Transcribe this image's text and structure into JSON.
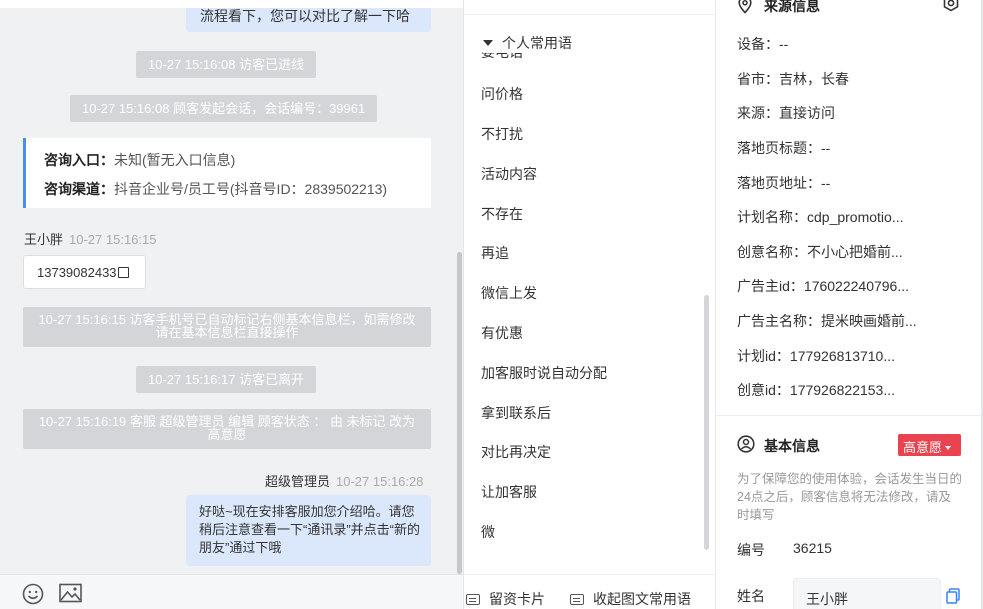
{
  "chat": {
    "top_bubble_text": "流程看下，您可以对比了解一下哈",
    "sys_visitor_enter": "10-27 15:16:08 访客已进线",
    "sys_session_start": "10-27 15:16:08 顾客发起会话，会话编号：39961",
    "consult": {
      "entry_label": "咨询入口：",
      "entry_value": "未知(暂无入口信息)",
      "channel_label": "咨询渠道：",
      "channel_value": "抖音企业号/员工号(抖音号ID：2839502213)"
    },
    "visitor_name": "王小胖",
    "visitor_time": "10-27 15:16:15",
    "visitor_phone": "13739082433",
    "sys_phone_marked": "10-27 15:16:15 访客手机号已自动标记右侧基本信息栏，如需修改请在基本信息栏直接操作",
    "sys_visitor_left": "10-27 15:16:17 访客已离开",
    "sys_status_edit": "10-27 15:16:19 客服 超级管理员 编辑 顾客状态 ： 由 未标记 改为 高意愿",
    "agent_name": "超级管理员",
    "agent_time": "10-27 15:16:28",
    "agent_message": "好哒~现在安排客服加您介绍哈。请您稍后注意查看一下“通讯录”并点击“新的朋友”通过下哦"
  },
  "phrases": {
    "group_title": "个人常用语",
    "clipped_item": "要电话",
    "items": [
      "问价格",
      "不打扰",
      "活动内容",
      "不存在",
      "再追",
      "微信上发",
      "有优惠",
      "加客服时说自动分配",
      "拿到联系后",
      "对比再决定",
      "让加客服",
      "微"
    ],
    "btn_card": "留资卡片",
    "btn_collapse": "收起图文常用语"
  },
  "info": {
    "source_title": "来源信息",
    "rows": [
      {
        "label": "设备：",
        "value": "--"
      },
      {
        "label": "省市：",
        "value": "吉林，长春"
      },
      {
        "label": "来源：",
        "value": "直接访问"
      },
      {
        "label": "落地页标题：",
        "value": "--"
      },
      {
        "label": "落地页地址：",
        "value": "--"
      },
      {
        "label": "计划名称：",
        "value": "cdp_promotio..."
      },
      {
        "label": "创意名称：",
        "value": "不小心把婚前..."
      },
      {
        "label": "广告主id：",
        "value": "176022240796..."
      },
      {
        "label": "广告主名称：",
        "value": "提米映画婚前..."
      },
      {
        "label": "计划id：",
        "value": "177926813710..."
      },
      {
        "label": "创意id：",
        "value": "177926822153..."
      }
    ],
    "basic_title": "基本信息",
    "intent_badge": "高意愿",
    "notice": "为了保障您的使用体验，会话发生当日的24点之后，顾客信息将无法修改，请及时填写",
    "number_label": "编号",
    "number_value": "36215",
    "name_label": "姓名",
    "name_value": "王小胖"
  },
  "colors": {
    "accent_blue": "#4a8df0",
    "bubble_blue": "#dbe8fc",
    "badge_red": "#e8434e",
    "system_gray": "#d3d5d8"
  }
}
